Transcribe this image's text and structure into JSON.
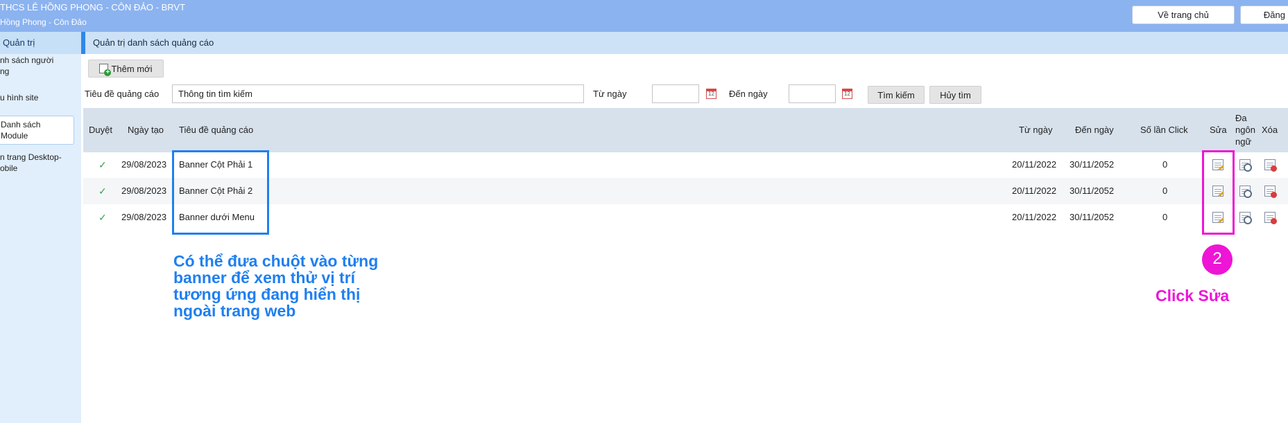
{
  "header": {
    "title": "THCS LÊ HỒNG PHONG - CÔN ĐẢO - BRVT",
    "subtitle": "Hồng Phong - Côn Đảo",
    "home_label": "Về trang chủ",
    "logout_label": "Đăng xuất",
    "bg_color": "#8bb3f0"
  },
  "sidebar": {
    "heading": "Quản trị",
    "items": [
      {
        "label": "nh sách người\nng"
      },
      {
        "label": "u hình site"
      },
      {
        "label": "Danh sách\nModule"
      },
      {
        "label": "n trang Desktop-\nobile"
      }
    ]
  },
  "main": {
    "heading": "Quản trị danh sách quảng cáo",
    "add_label": "Thêm mới",
    "search": {
      "title_label": "Tiêu đề quảng cáo",
      "title_value": "Thông tin tìm kiếm",
      "from_label": "Từ ngày",
      "to_label": "Đến ngày",
      "calendar_glyph": "12",
      "search_label": "Tìm kiếm",
      "cancel_label": "Hủy tìm"
    },
    "table": {
      "columns": [
        "Duyệt",
        "Ngày tạo",
        "Tiêu đề quảng cáo",
        "Từ ngày",
        "Đến ngày",
        "Số lần Click",
        "Sửa",
        "Đa\nngôn\nngữ",
        "Xóa"
      ],
      "rows": [
        {
          "approved": "✓",
          "created": "29/08/2023",
          "title": "Banner Cột Phải 1",
          "from": "20/11/2022",
          "to": "30/11/2052",
          "clicks": "0"
        },
        {
          "approved": "✓",
          "created": "29/08/2023",
          "title": "Banner Cột Phải 2",
          "from": "20/11/2022",
          "to": "30/11/2052",
          "clicks": "0"
        },
        {
          "approved": "✓",
          "created": "29/08/2023",
          "title": "Banner dưới Menu",
          "from": "20/11/2022",
          "to": "30/11/2052",
          "clicks": "0"
        }
      ]
    }
  },
  "annotations": {
    "blue_note": "Có thể đưa chuột vào từng banner để xem thử vị trí tương ứng đang hiển thị ngoài trang web",
    "step_number": "2",
    "pink_note": "Click Sửa",
    "blue_color": "#1f7ff0",
    "pink_color": "#ee15d6"
  }
}
